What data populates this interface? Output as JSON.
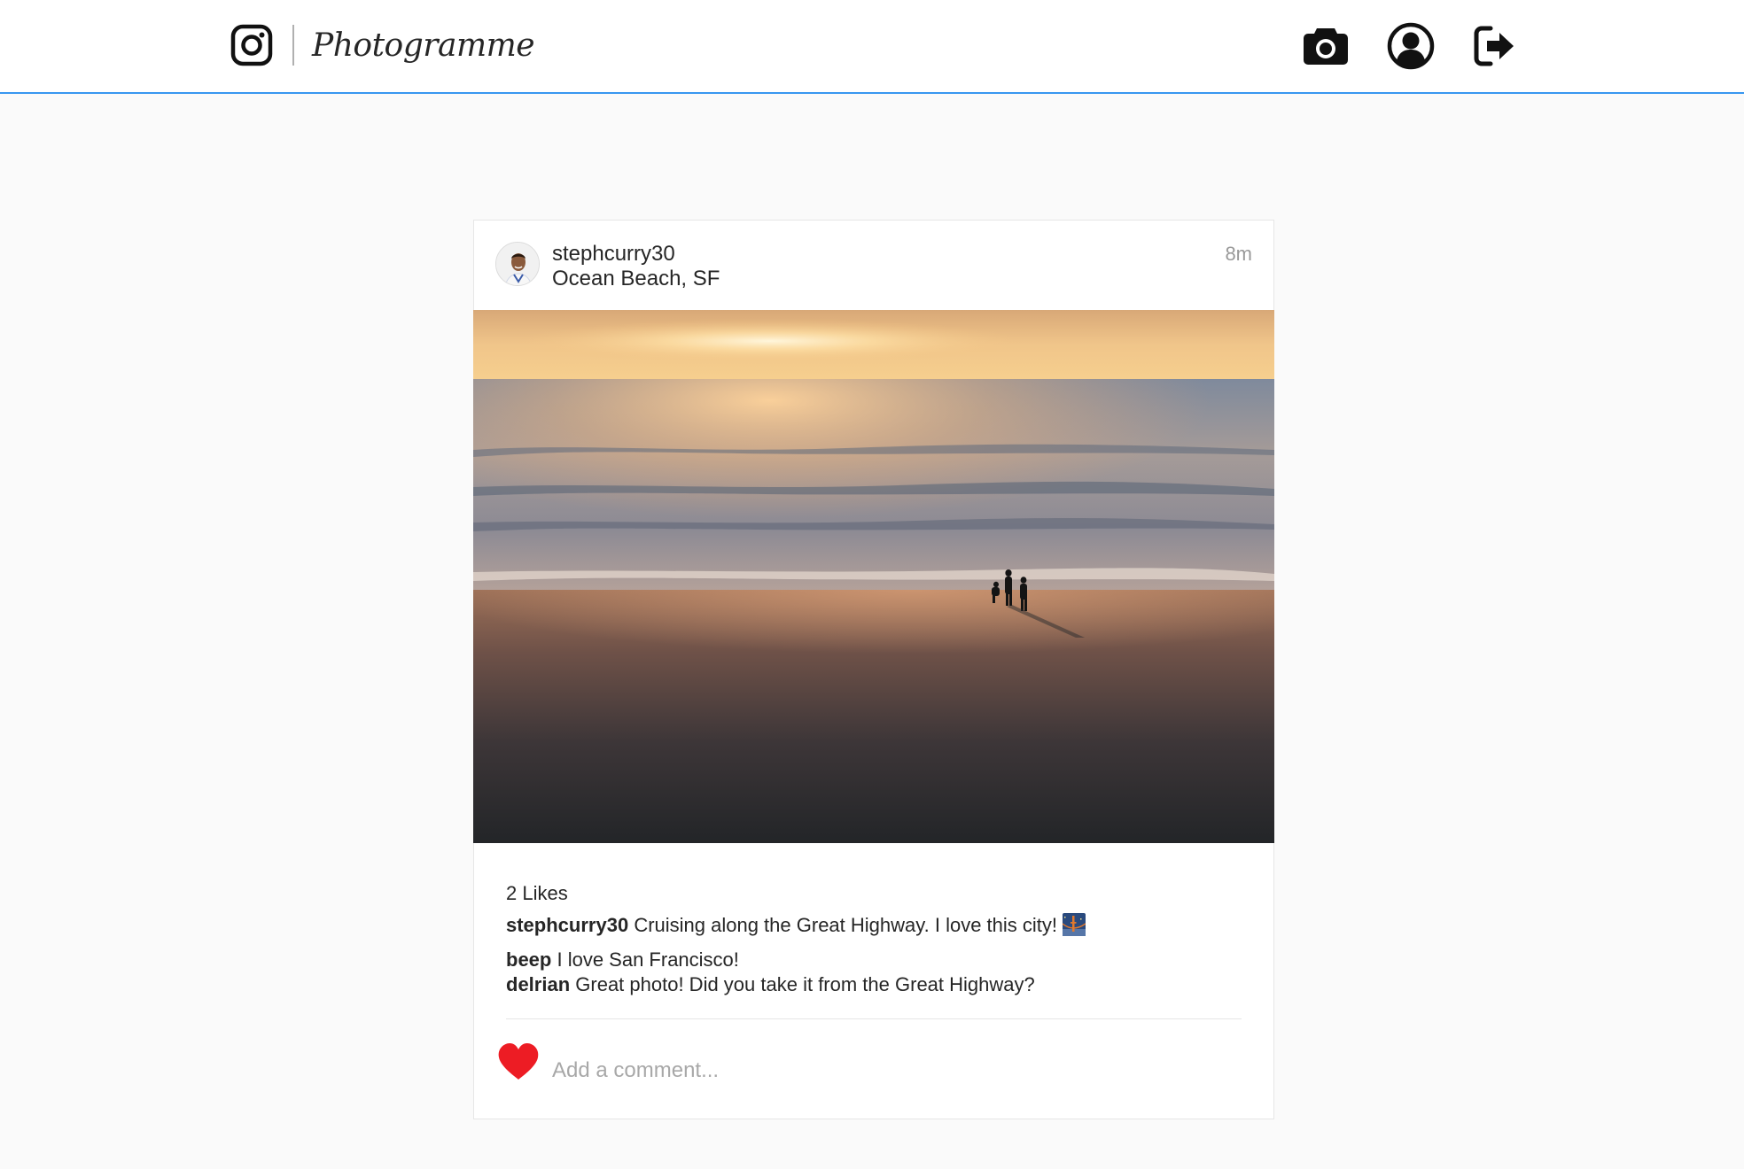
{
  "app": {
    "name": "Photogramme",
    "accent_color": "#3897f0"
  },
  "navbar": {
    "icons": [
      "instagram-logo-icon",
      "camera-icon",
      "user-profile-icon",
      "logout-icon"
    ]
  },
  "post": {
    "username": "stephcurry30",
    "location": "Ocean Beach, SF",
    "timestamp": "8m",
    "likes": "2 Likes",
    "caption": {
      "user": "stephcurry30",
      "text": "Cruising along the Great Highway. I love this city!",
      "emoji": "bridge-at-night-emoji"
    },
    "comments": [
      {
        "user": "beep",
        "text": "I love San Francisco!"
      },
      {
        "user": "delrian",
        "text": "Great photo! Did you take it from the Great Highway?"
      }
    ],
    "liked": true,
    "like_color": "#ed4956",
    "comment_placeholder": "Add a comment..."
  }
}
